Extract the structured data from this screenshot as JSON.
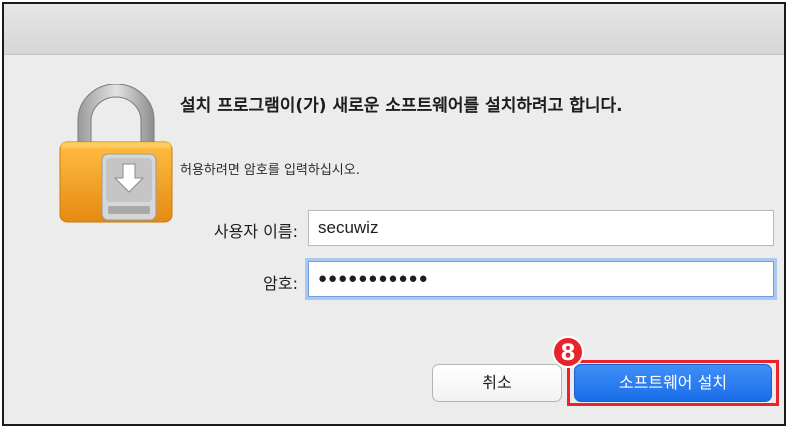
{
  "dialog": {
    "title": "설치 프로그램이(가) 새로운 소프트웨어를 설치하려고 합니다.",
    "subtitle": "허용하려면 암호를 입력하십시오."
  },
  "form": {
    "username_label": "사용자 이름:",
    "username_value": "secuwiz",
    "password_label": "암호:",
    "password_mask": "●●●●●●●●●●●"
  },
  "buttons": {
    "cancel_label": "취소",
    "install_label": "소프트웨어 설치"
  },
  "annotation": {
    "step_number": "8"
  },
  "icons": {
    "lock": "lock-icon",
    "download": "download-icon"
  },
  "colors": {
    "accent": "#1a6de8",
    "highlight": "#e8232a",
    "lock_body": "#f2a323"
  }
}
